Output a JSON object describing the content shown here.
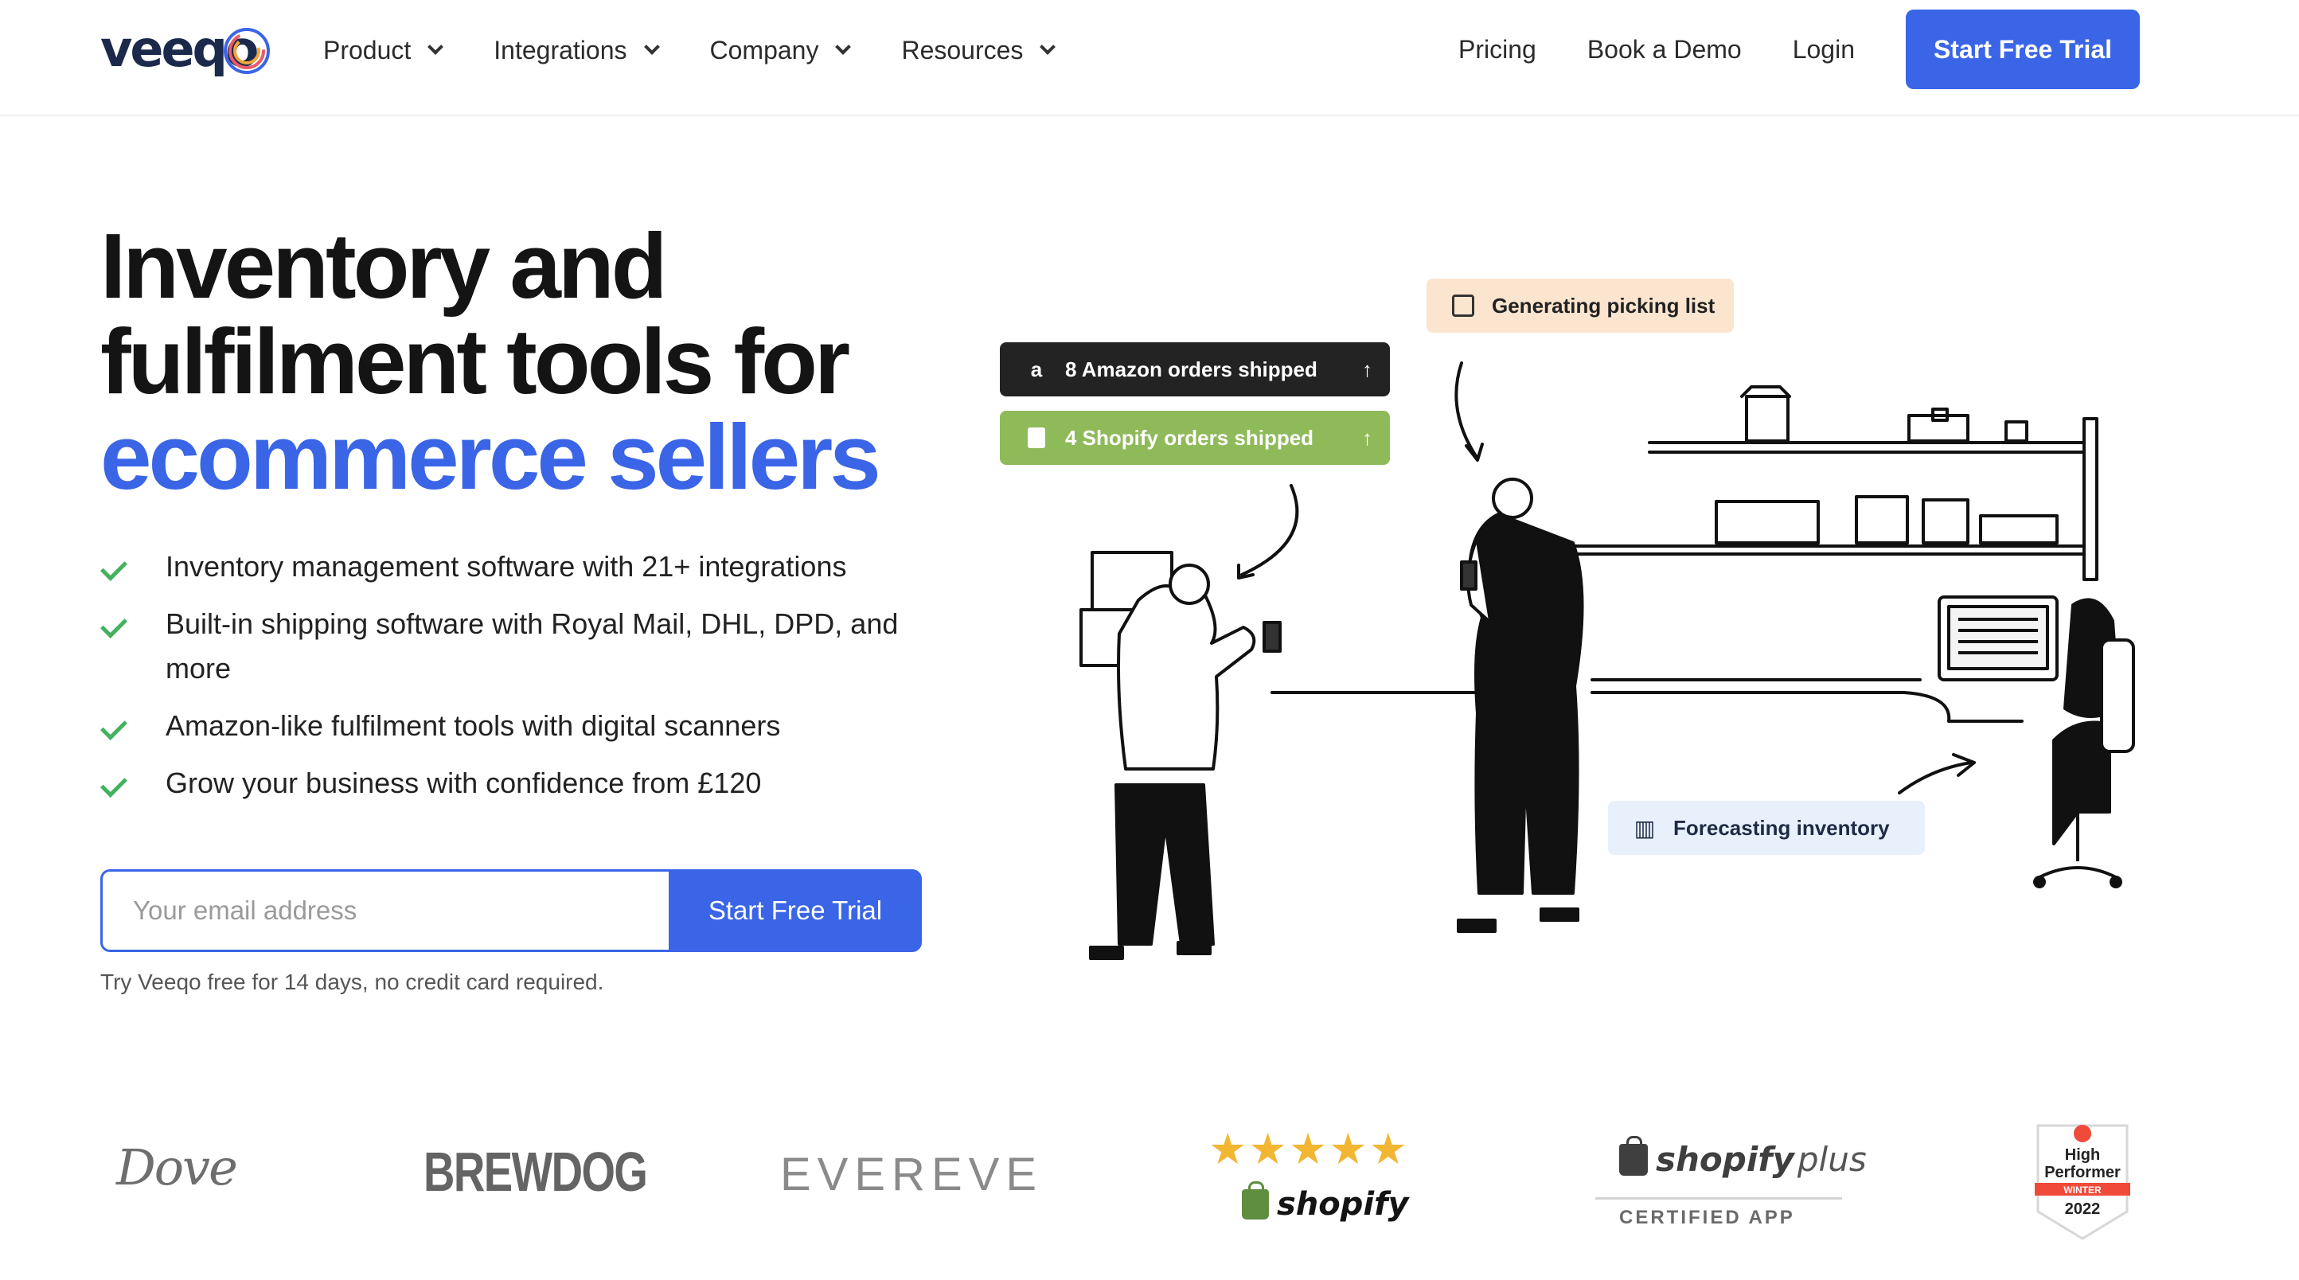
{
  "header": {
    "logo_text": "veeqo",
    "nav": [
      {
        "label": "Product"
      },
      {
        "label": "Integrations"
      },
      {
        "label": "Company"
      },
      {
        "label": "Resources"
      }
    ],
    "links": {
      "pricing": "Pricing",
      "demo": "Book a Demo",
      "login": "Login"
    },
    "cta": "Start Free Trial"
  },
  "hero": {
    "title_line1": "Inventory and",
    "title_line2": "fulfilment tools for",
    "title_line3": "ecommerce sellers",
    "bullets": [
      "Inventory management software with 21+ integrations",
      "Built-in shipping software with Royal Mail, DHL, DPD, and more",
      "Amazon-like fulfilment tools with digital scanners",
      "Grow your business with confidence from £120"
    ],
    "email_placeholder": "Your email address",
    "submit_label": "Start Free Trial",
    "note": "Try Veeqo free for 14 days, no credit card required."
  },
  "illustration": {
    "amazon_pill": "8 Amazon orders shipped",
    "shopify_pill": "4 Shopify orders shipped",
    "picking_pill": "Generating picking list",
    "forecast_pill": "Forecasting inventory"
  },
  "logos": {
    "dove": "Dove",
    "brewdog": "BREWDOG",
    "evereve": "EVEREVE",
    "stars": "★★★★★",
    "shopify": "shopify",
    "shopify_plus_main": "shopify",
    "shopify_plus_suffix": "plus",
    "certified": "CERTIFIED APP",
    "g2_line1": "High",
    "g2_line2": "Performer",
    "g2_season": "WINTER",
    "g2_year": "2022"
  },
  "colors": {
    "accent": "#3a65e6",
    "check": "#44b15f",
    "amazon_pill": "#232323",
    "shopify_pill": "#8fba5a",
    "picking_pill": "#fbe5cf",
    "forecast_pill": "#e8f0fb"
  }
}
